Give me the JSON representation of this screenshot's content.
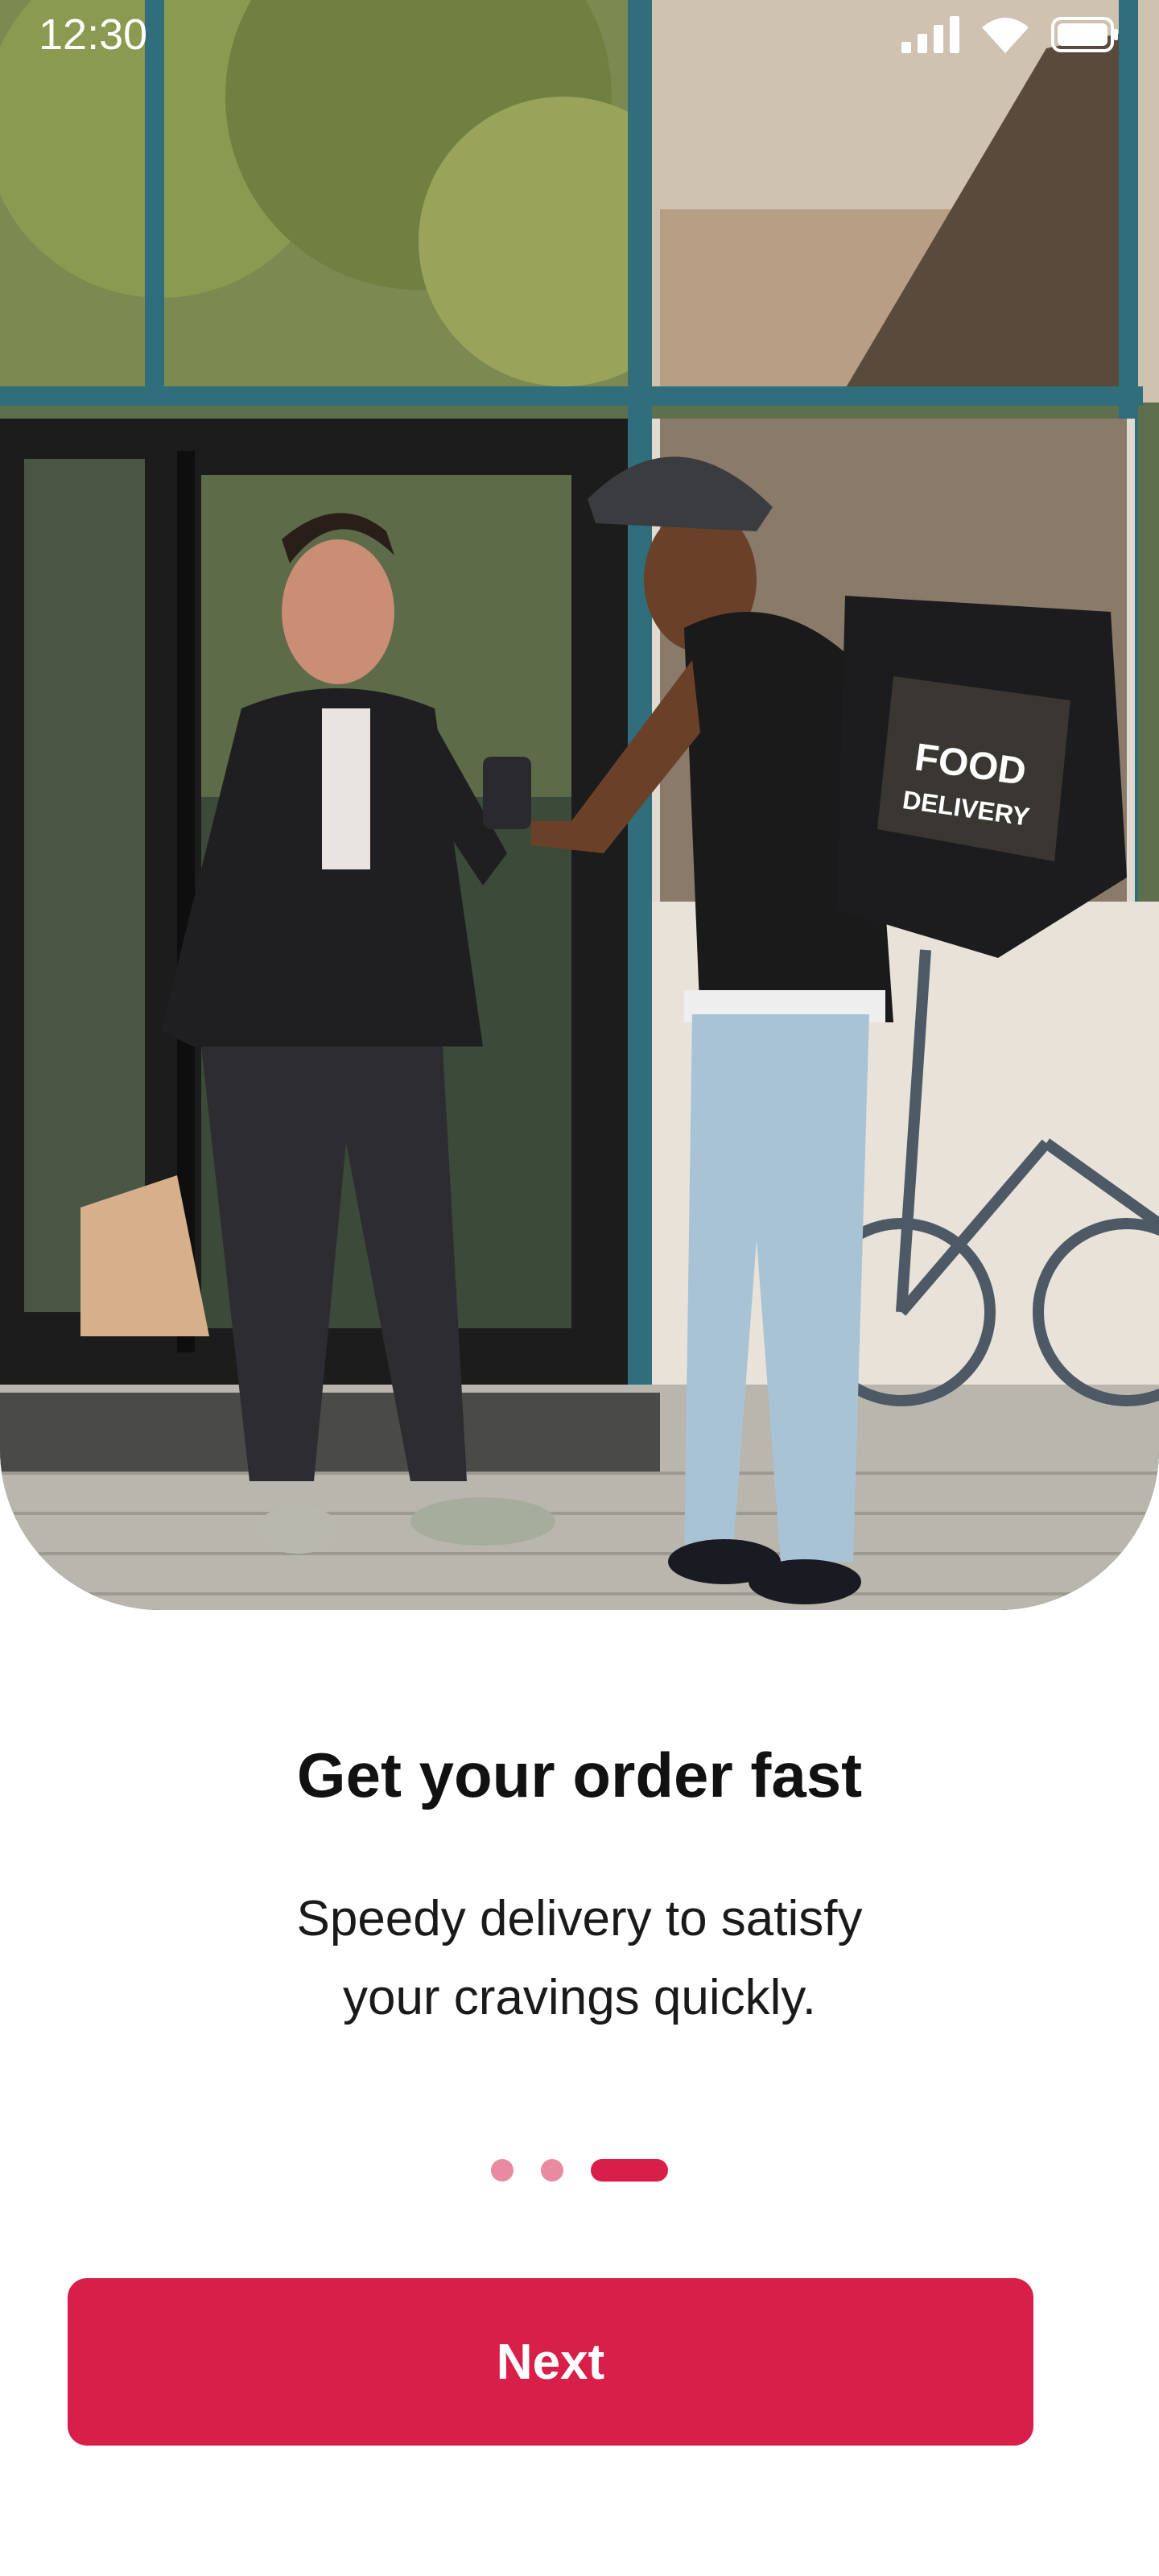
{
  "status_bar": {
    "time": "12:30"
  },
  "hero": {
    "bag_text_line1": "FOOD",
    "bag_text_line2": "DELIVERY"
  },
  "onboarding": {
    "title": "Get your order fast",
    "subtitle_line1": "Speedy delivery to satisfy",
    "subtitle_line2": "your cravings quickly.",
    "page_count": 3,
    "active_page": 3
  },
  "actions": {
    "next_label": "Next"
  },
  "colors": {
    "accent": "#d81f4a",
    "inactive_dot": "#e88aa0"
  }
}
